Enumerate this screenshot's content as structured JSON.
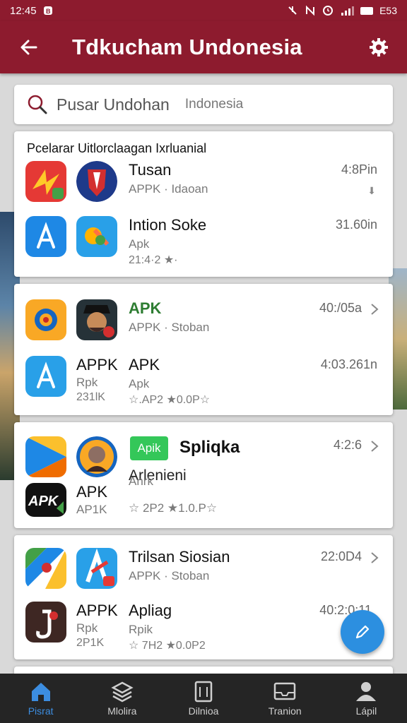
{
  "status_bar": {
    "time": "12:45",
    "battery": "E53"
  },
  "app_bar": {
    "title": "Tdkucham Undonesia"
  },
  "search": {
    "placeholder": "Pusar Undohan",
    "region": "Indonesia"
  },
  "colors": {
    "brand": "#8d1b2e",
    "accent": "#2c8fe0",
    "nav_bg": "#252525"
  },
  "cards": [
    {
      "header": "Pcelarar Uitlorclaagan Ixrluanial",
      "rows": [
        {
          "name": "Tusan",
          "sub": "APPK · Idaoan",
          "time": "4:8Pin"
        },
        {
          "name": "Intion Soke",
          "sub": "Apk",
          "sub2": "21:4·2 ★·",
          "time": "31.60in"
        }
      ]
    },
    {
      "rows": [
        {
          "name": "APK",
          "sub": "APPK · Stoban",
          "time": "40:/05a"
        },
        {
          "left_name": "APPK",
          "left_sub": "Rpk",
          "left_sub2": "231lK",
          "name": "APK",
          "sub": "Apk",
          "sub2": "☆.AP2  ★0.0P☆",
          "time": "4:03.261n"
        }
      ]
    },
    {
      "rows": [
        {
          "badge": "Apik",
          "name": "Spliqka",
          "time": "4:2:6",
          "sub": "Arlenieni"
        },
        {
          "left_name": "APK",
          "left_sub": "AP1K",
          "name": "",
          "sub": "Anrk",
          "sub2": "☆ 2P2  ★1.0.P☆",
          "time": ""
        }
      ]
    },
    {
      "rows": [
        {
          "name": "Trilsan Siosian",
          "sub": "APPK · Stoban",
          "time": "22:0D4"
        },
        {
          "left_name": "APPK",
          "left_sub": "Rpk",
          "left_sub2": "2P1K",
          "name": "Apliag",
          "sub": "Rpik",
          "sub2": "☆ 7H2  ★0.0P2",
          "time": "40:2:0:11"
        }
      ]
    }
  ],
  "bottom_nav": [
    {
      "label": "Pisrat",
      "icon": "home-icon",
      "active": true
    },
    {
      "label": "Mlolira",
      "icon": "layers-icon",
      "active": false
    },
    {
      "label": "Dilnioa",
      "icon": "tablet-icon",
      "active": false
    },
    {
      "label": "Tranion",
      "icon": "inbox-icon",
      "active": false
    },
    {
      "label": "Lápil",
      "icon": "person-icon",
      "active": false
    }
  ]
}
